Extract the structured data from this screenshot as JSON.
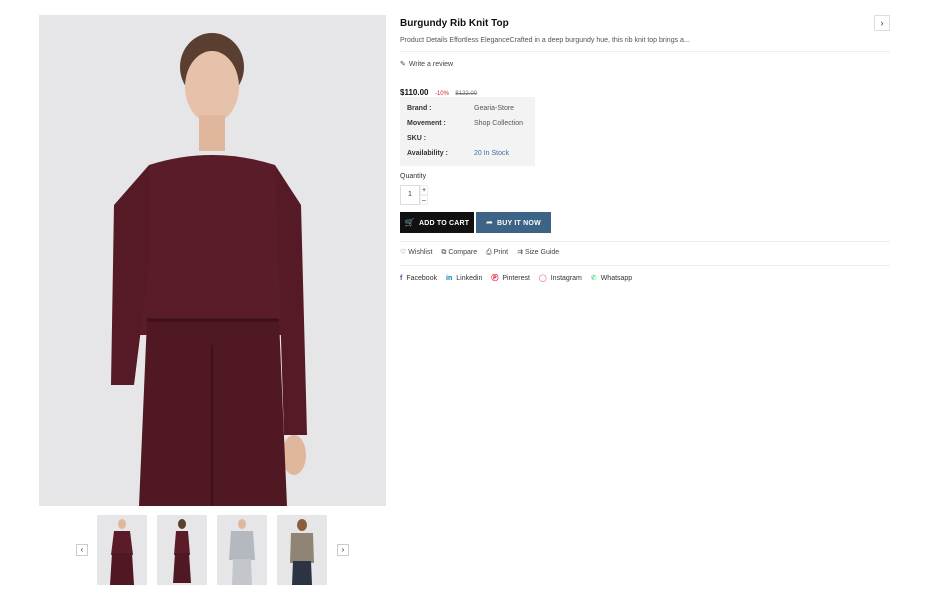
{
  "product": {
    "title": "Burgundy Rib Knit Top",
    "description": "Product Details Effortless EleganceCrafted in a deep burgundy hue, this rib knit top brings a...",
    "write_review": "Write a review",
    "price": "$110.00",
    "discount": "-10%",
    "old_price": "$122.00",
    "meta": [
      {
        "key": "Brand :",
        "value": "Gearia-Store"
      },
      {
        "key": "Movement :",
        "value": "Shop Collection"
      },
      {
        "key": "SKU :",
        "value": ""
      },
      {
        "key": "Availability :",
        "value": "20 In Stock"
      }
    ],
    "quantity_label": "Quantity",
    "quantity_value": "1",
    "add_to_cart": "ADD TO CART",
    "buy_it_now": "BUY IT NOW",
    "actions": [
      "Wishlist",
      "Compare",
      "Print",
      "Size Guide"
    ],
    "social": [
      "Facebook",
      "Linkedin",
      "Pinterest",
      "Instagram",
      "Whatsapp"
    ]
  },
  "icons": {
    "next_product": "chevron-right-icon",
    "thumb_prev": "chevron-left-icon",
    "thumb_next": "chevron-right-icon"
  },
  "colors": {
    "garment": "#5a1c28",
    "buy_button": "#3d6486",
    "discount": "#e02424",
    "stock": "#3b6fa0"
  }
}
